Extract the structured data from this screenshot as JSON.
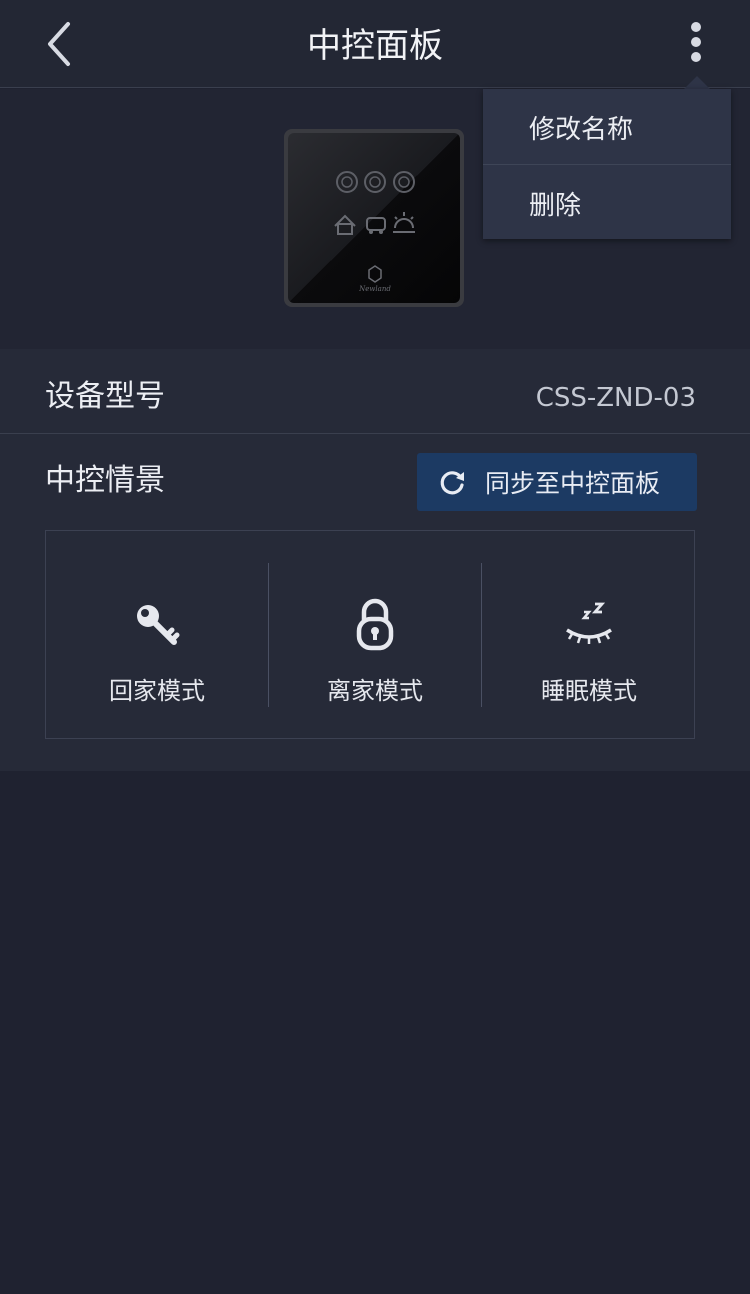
{
  "header": {
    "title": "中控面板",
    "back_icon": "chevron-left-icon",
    "more_icon": "more-vertical-icon"
  },
  "menu": {
    "items": [
      {
        "label": "修改名称"
      },
      {
        "label": "删除"
      }
    ]
  },
  "device": {
    "image": "smart-panel-device-image",
    "logo_text": "Newland",
    "model_label": "设备型号",
    "model_value": "CSS-ZND-03"
  },
  "scenes": {
    "label": "中控情景",
    "sync_button_label": "同步至中控面板",
    "sync_icon": "refresh-icon",
    "items": [
      {
        "label": "回家模式",
        "icon": "key-icon"
      },
      {
        "label": "离家模式",
        "icon": "padlock-icon"
      },
      {
        "label": "睡眠模式",
        "icon": "sleep-icon"
      }
    ]
  },
  "colors": {
    "background": "#1f2230",
    "header": "#232734",
    "accent_button": "#1c3a63",
    "menu_bg": "#2e3447"
  }
}
